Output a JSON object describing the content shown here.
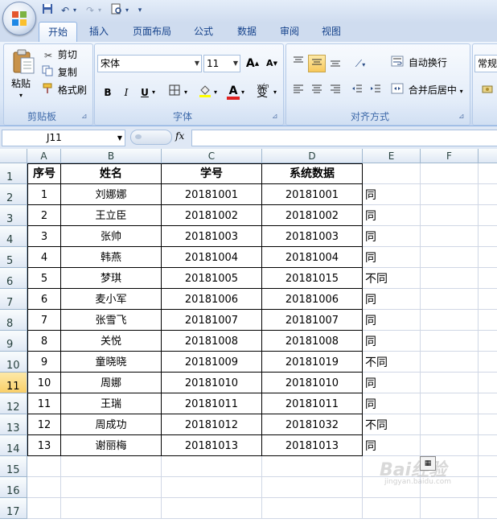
{
  "window": {
    "quick_access": [
      "save-icon",
      "undo-icon",
      "redo-icon",
      "print-preview-icon",
      "customize-icon"
    ]
  },
  "tabs": [
    "开始",
    "插入",
    "页面布局",
    "公式",
    "数据",
    "审阅",
    "视图"
  ],
  "active_tab": "开始",
  "ribbon": {
    "clipboard": {
      "paste": "粘贴",
      "cut": "剪切",
      "copy": "复制",
      "format_painter": "格式刷",
      "group_label": "剪贴板"
    },
    "font": {
      "font_name": "宋体",
      "font_size": "11",
      "bold": "B",
      "italic": "I",
      "underline": "U",
      "grow": "A",
      "shrink": "A",
      "font_color_glyph": "A",
      "phonetic": "变",
      "phonetic_top": "wén",
      "group_label": "字体"
    },
    "alignment": {
      "wrap_text": "自动换行",
      "merge_center": "合并后居中",
      "group_label": "对齐方式"
    },
    "number": {
      "format": "常规"
    }
  },
  "formula_bar": {
    "name_box": "J11",
    "fx": "fx",
    "formula": ""
  },
  "sheet": {
    "columns": [
      "A",
      "B",
      "C",
      "D",
      "E",
      "F"
    ],
    "row_numbers": [
      "1",
      "2",
      "3",
      "4",
      "5",
      "6",
      "7",
      "8",
      "9",
      "10",
      "11",
      "12",
      "13",
      "14",
      "15",
      "16",
      "17"
    ],
    "selected_row": "11",
    "headers": [
      "序号",
      "姓名",
      "学号",
      "系统数据"
    ],
    "rows": [
      [
        "1",
        "刘娜娜",
        "20181001",
        "20181001",
        "同"
      ],
      [
        "2",
        "王立臣",
        "20181002",
        "20181002",
        "同"
      ],
      [
        "3",
        "张帅",
        "20181003",
        "20181003",
        "同"
      ],
      [
        "4",
        "韩燕",
        "20181004",
        "20181004",
        "同"
      ],
      [
        "5",
        "梦琪",
        "20181005",
        "20181015",
        "不同"
      ],
      [
        "6",
        "麦小军",
        "20181006",
        "20181006",
        "同"
      ],
      [
        "7",
        "张雪飞",
        "20181007",
        "20181007",
        "同"
      ],
      [
        "8",
        "关悦",
        "20181008",
        "20181008",
        "同"
      ],
      [
        "9",
        "童晓晓",
        "20181009",
        "20181019",
        "不同"
      ],
      [
        "10",
        "周娜",
        "20181010",
        "20181010",
        "同"
      ],
      [
        "11",
        "王瑞",
        "20181011",
        "20181011",
        "同"
      ],
      [
        "12",
        "周成功",
        "20181012",
        "20181032",
        "不同"
      ],
      [
        "13",
        "谢丽梅",
        "20181013",
        "20181013",
        "同"
      ]
    ]
  },
  "watermark": {
    "main": "Bai经验",
    "sub": "jingyan.baidu.com"
  }
}
